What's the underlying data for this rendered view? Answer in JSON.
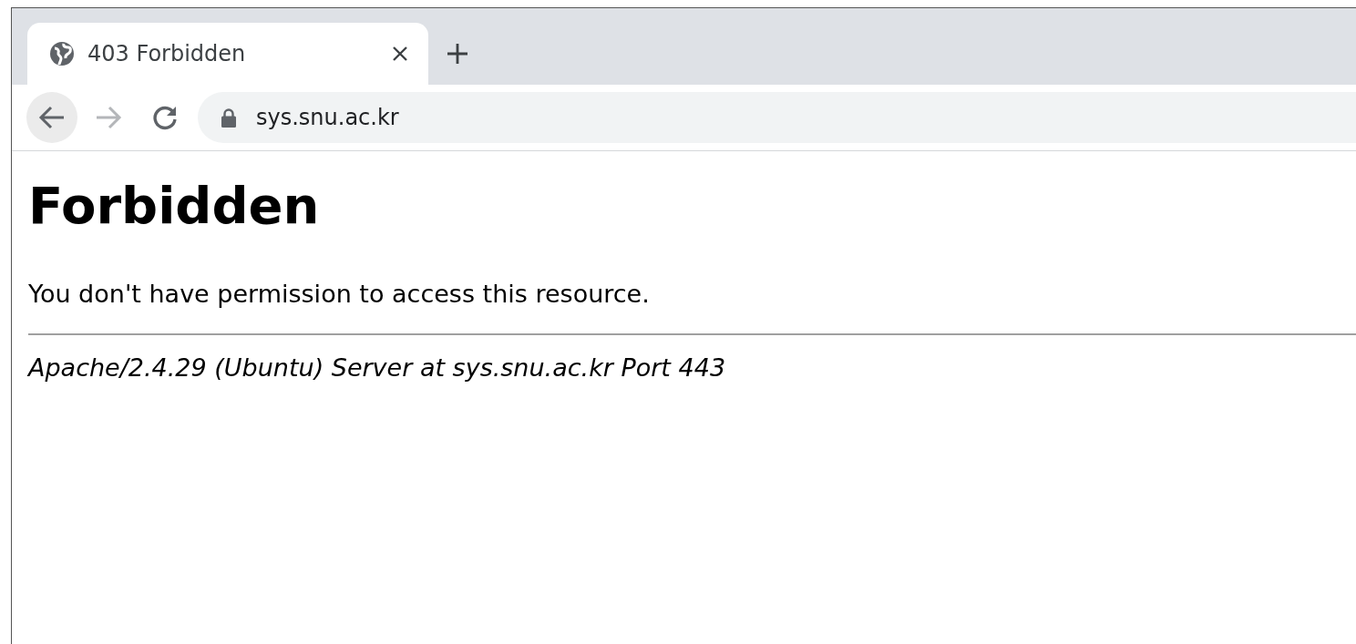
{
  "tabs": [
    {
      "title": "403 Forbidden",
      "selected": true
    }
  ],
  "toolbar": {
    "back": {
      "disabled": false
    },
    "forward": {
      "disabled": true
    }
  },
  "address_bar": {
    "url": "sys.snu.ac.kr",
    "secure": true
  },
  "page": {
    "heading": "Forbidden",
    "message": "You don't have permission to access this resource.",
    "footer": "Apache/2.4.29 (Ubuntu) Server at sys.snu.ac.kr Port 443"
  }
}
